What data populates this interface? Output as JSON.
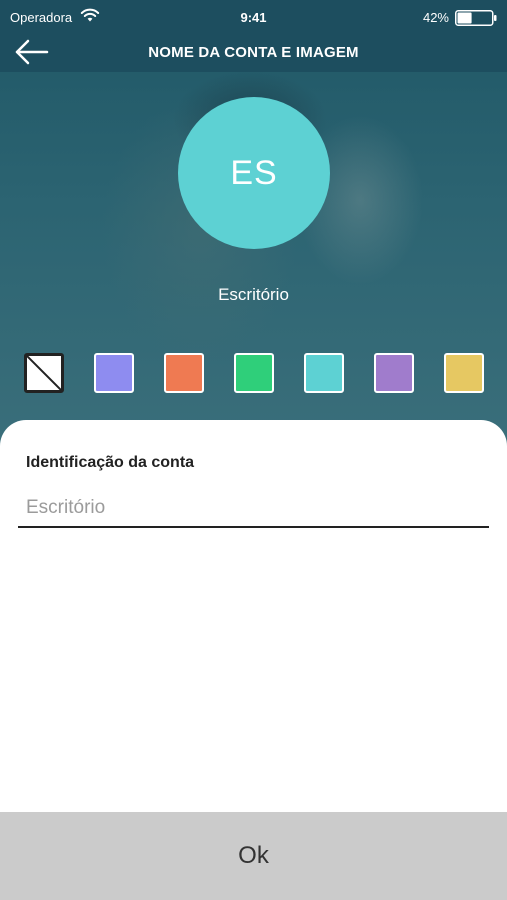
{
  "status_bar": {
    "carrier": "Operadora",
    "time": "9:41",
    "battery_percent": "42%",
    "battery_level": 0.42,
    "icons": [
      "wifi-icon",
      "battery-icon"
    ]
  },
  "header": {
    "title": "NOME DA CONTA E IMAGEM",
    "back_icon": "arrow-left-icon"
  },
  "avatar": {
    "initials": "ES",
    "color": "#5dd1d3"
  },
  "account_name_display": "Escritório",
  "color_options": [
    {
      "name": "none",
      "color": "#ffffff",
      "icon": "no-color-icon"
    },
    {
      "name": "periwinkle",
      "color": "#8e8cf0"
    },
    {
      "name": "coral",
      "color": "#ef7a52"
    },
    {
      "name": "green",
      "color": "#2fcf7a"
    },
    {
      "name": "turquoise",
      "color": "#5dd1d3"
    },
    {
      "name": "lavender",
      "color": "#a07ccc"
    },
    {
      "name": "mustard",
      "color": "#e6c862"
    }
  ],
  "form": {
    "label": "Identificação da conta",
    "placeholder": "Escritório",
    "value": ""
  },
  "footer": {
    "ok_label": "Ok"
  }
}
